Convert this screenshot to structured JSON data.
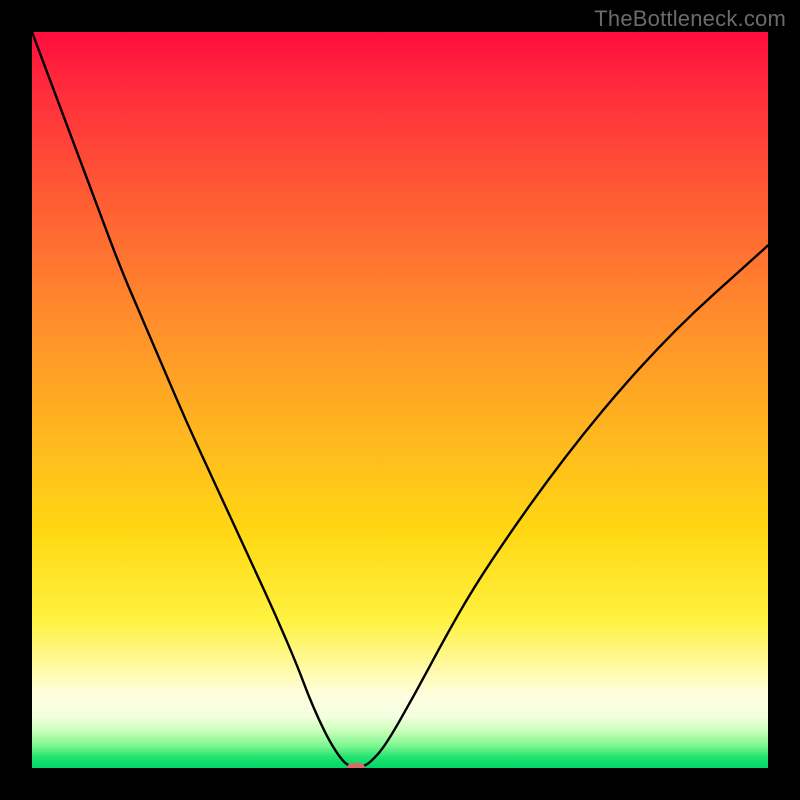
{
  "watermark": {
    "text": "TheBottleneck.com"
  },
  "colors": {
    "curve_stroke": "#000000",
    "marker_fill": "#d86a6a",
    "frame": "#000000"
  },
  "chart_data": {
    "type": "line",
    "title": "",
    "xlabel": "",
    "ylabel": "",
    "xlim": [
      0,
      100
    ],
    "ylim": [
      0,
      100
    ],
    "grid": false,
    "legend": false,
    "series": [
      {
        "name": "bottleneck-curve",
        "x": [
          0,
          3,
          6,
          9,
          12,
          15,
          18,
          21,
          24,
          27,
          30,
          33,
          36,
          37.5,
          39,
          40.5,
          42,
          43,
          44,
          45,
          46,
          48,
          52,
          56,
          60,
          65,
          70,
          75,
          80,
          85,
          90,
          95,
          100
        ],
        "y": [
          100,
          92,
          84,
          76,
          68,
          61,
          54,
          47,
          40.5,
          34,
          27.5,
          21,
          14,
          10,
          6.5,
          3.5,
          1.2,
          0.3,
          0.0,
          0.2,
          0.8,
          3.0,
          10.0,
          17.5,
          24.5,
          32.0,
          39.0,
          45.5,
          51.5,
          57.0,
          62.0,
          66.5,
          71.0
        ]
      }
    ],
    "marker": {
      "x": 44,
      "y": 0
    },
    "background_bands_meaning": "red=high-bottleneck, green=low-bottleneck"
  }
}
